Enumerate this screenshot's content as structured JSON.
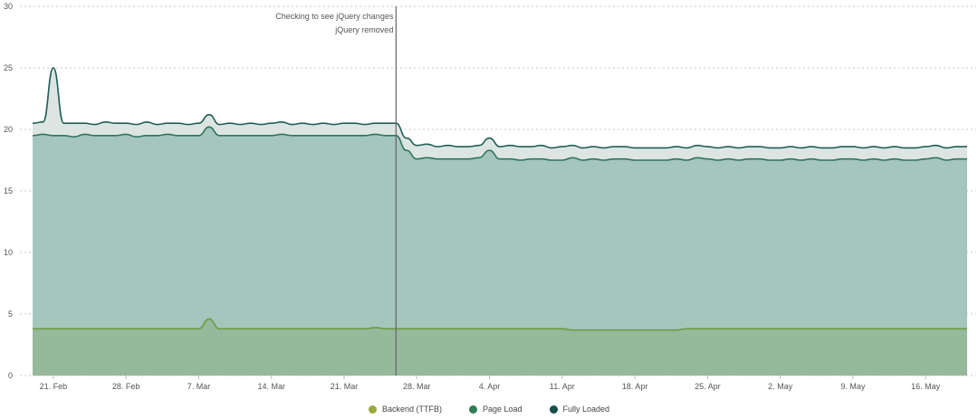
{
  "chart_data": {
    "type": "area",
    "title": "",
    "xlabel": "",
    "ylabel": "",
    "ylim": [
      0,
      30
    ],
    "y_ticks": [
      0,
      5,
      10,
      15,
      20,
      25,
      30
    ],
    "x_ticks": [
      "21. Feb",
      "28. Feb",
      "7. Mar",
      "14. Mar",
      "21. Mar",
      "28. Mar",
      "4. Apr",
      "11. Apr",
      "18. Apr",
      "25. Apr",
      "2. May",
      "9. May",
      "16. May"
    ],
    "x": [
      "2019-02-19",
      "2019-02-20",
      "2019-02-21",
      "2019-02-22",
      "2019-02-23",
      "2019-02-24",
      "2019-02-25",
      "2019-02-26",
      "2019-02-27",
      "2019-02-28",
      "2019-03-01",
      "2019-03-02",
      "2019-03-03",
      "2019-03-04",
      "2019-03-05",
      "2019-03-06",
      "2019-03-07",
      "2019-03-08",
      "2019-03-09",
      "2019-03-10",
      "2019-03-11",
      "2019-03-12",
      "2019-03-13",
      "2019-03-14",
      "2019-03-15",
      "2019-03-16",
      "2019-03-17",
      "2019-03-18",
      "2019-03-19",
      "2019-03-20",
      "2019-03-21",
      "2019-03-22",
      "2019-03-23",
      "2019-03-24",
      "2019-03-25",
      "2019-03-26",
      "2019-03-27",
      "2019-03-28",
      "2019-03-29",
      "2019-03-30",
      "2019-03-31",
      "2019-04-01",
      "2019-04-02",
      "2019-04-03",
      "2019-04-04",
      "2019-04-05",
      "2019-04-06",
      "2019-04-07",
      "2019-04-08",
      "2019-04-09",
      "2019-04-10",
      "2019-04-11",
      "2019-04-12",
      "2019-04-13",
      "2019-04-14",
      "2019-04-15",
      "2019-04-16",
      "2019-04-17",
      "2019-04-18",
      "2019-04-19",
      "2019-04-20",
      "2019-04-21",
      "2019-04-22",
      "2019-04-23",
      "2019-04-24",
      "2019-04-25",
      "2019-04-26",
      "2019-04-27",
      "2019-04-28",
      "2019-04-29",
      "2019-04-30",
      "2019-05-01",
      "2019-05-02",
      "2019-05-03",
      "2019-05-04",
      "2019-05-05",
      "2019-05-06",
      "2019-05-07",
      "2019-05-08",
      "2019-05-09",
      "2019-05-10",
      "2019-05-11",
      "2019-05-12",
      "2019-05-13",
      "2019-05-14",
      "2019-05-15",
      "2019-05-16",
      "2019-05-17",
      "2019-05-18",
      "2019-05-19",
      "2019-05-20"
    ],
    "series": [
      {
        "name": "Fully Loaded",
        "color": "#1f5e55",
        "fill": "#dde5e2",
        "values": [
          20.5,
          20.6,
          25.0,
          20.5,
          20.5,
          20.5,
          20.4,
          20.6,
          20.5,
          20.5,
          20.4,
          20.6,
          20.4,
          20.5,
          20.5,
          20.4,
          20.5,
          21.2,
          20.4,
          20.5,
          20.4,
          20.5,
          20.4,
          20.5,
          20.6,
          20.4,
          20.5,
          20.4,
          20.5,
          20.4,
          20.5,
          20.5,
          20.4,
          20.5,
          20.5,
          20.5,
          19.3,
          18.7,
          18.8,
          18.6,
          18.7,
          18.6,
          18.6,
          18.7,
          19.3,
          18.6,
          18.7,
          18.6,
          18.6,
          18.7,
          18.5,
          18.6,
          18.7,
          18.5,
          18.6,
          18.5,
          18.6,
          18.6,
          18.5,
          18.5,
          18.5,
          18.5,
          18.6,
          18.5,
          18.7,
          18.6,
          18.5,
          18.6,
          18.5,
          18.6,
          18.6,
          18.5,
          18.5,
          18.6,
          18.5,
          18.6,
          18.5,
          18.5,
          18.6,
          18.6,
          18.5,
          18.6,
          18.5,
          18.6,
          18.5,
          18.5,
          18.6,
          18.7,
          18.5,
          18.6,
          18.6
        ]
      },
      {
        "name": "Page Load",
        "color": "#2e7560",
        "fill": "#a4c6bc",
        "values": [
          19.5,
          19.6,
          19.5,
          19.5,
          19.4,
          19.6,
          19.5,
          19.5,
          19.5,
          19.6,
          19.4,
          19.5,
          19.5,
          19.6,
          19.5,
          19.5,
          19.5,
          20.2,
          19.5,
          19.5,
          19.5,
          19.5,
          19.5,
          19.5,
          19.6,
          19.5,
          19.5,
          19.5,
          19.5,
          19.5,
          19.5,
          19.5,
          19.5,
          19.6,
          19.5,
          19.5,
          18.3,
          17.6,
          17.7,
          17.6,
          17.6,
          17.6,
          17.6,
          17.7,
          18.3,
          17.6,
          17.6,
          17.5,
          17.6,
          17.6,
          17.5,
          17.5,
          17.7,
          17.5,
          17.6,
          17.5,
          17.6,
          17.6,
          17.5,
          17.5,
          17.5,
          17.5,
          17.6,
          17.5,
          17.7,
          17.6,
          17.5,
          17.6,
          17.5,
          17.6,
          17.6,
          17.5,
          17.5,
          17.6,
          17.5,
          17.6,
          17.5,
          17.5,
          17.6,
          17.6,
          17.5,
          17.6,
          17.5,
          17.6,
          17.5,
          17.5,
          17.6,
          17.7,
          17.5,
          17.6,
          17.6
        ]
      },
      {
        "name": "Backend (TTFB)",
        "color": "#6e9a43",
        "fill": "#96b89b",
        "values": [
          3.8,
          3.8,
          3.8,
          3.8,
          3.8,
          3.8,
          3.8,
          3.8,
          3.8,
          3.8,
          3.8,
          3.8,
          3.8,
          3.8,
          3.8,
          3.8,
          3.8,
          4.6,
          3.8,
          3.8,
          3.8,
          3.8,
          3.8,
          3.8,
          3.8,
          3.8,
          3.8,
          3.8,
          3.8,
          3.8,
          3.8,
          3.8,
          3.8,
          3.9,
          3.8,
          3.8,
          3.8,
          3.8,
          3.8,
          3.8,
          3.8,
          3.8,
          3.8,
          3.8,
          3.8,
          3.8,
          3.8,
          3.8,
          3.8,
          3.8,
          3.8,
          3.8,
          3.7,
          3.7,
          3.7,
          3.7,
          3.7,
          3.7,
          3.7,
          3.7,
          3.7,
          3.7,
          3.7,
          3.8,
          3.8,
          3.8,
          3.8,
          3.8,
          3.8,
          3.8,
          3.8,
          3.8,
          3.8,
          3.8,
          3.8,
          3.8,
          3.8,
          3.8,
          3.8,
          3.8,
          3.8,
          3.8,
          3.8,
          3.8,
          3.8,
          3.8,
          3.8,
          3.8,
          3.8,
          3.8,
          3.8
        ]
      }
    ],
    "annotations": [
      {
        "x": "2019-03-26",
        "labels": [
          "Checking to see jQuery changes",
          "jQuery removed"
        ]
      }
    ],
    "grid": true,
    "legend_position": "bottom-center"
  },
  "legend": [
    {
      "label": "Backend (TTFB)",
      "color": "#9ba83a"
    },
    {
      "label": "Page Load",
      "color": "#2f7b54"
    },
    {
      "label": "Fully Loaded",
      "color": "#164f48"
    }
  ]
}
